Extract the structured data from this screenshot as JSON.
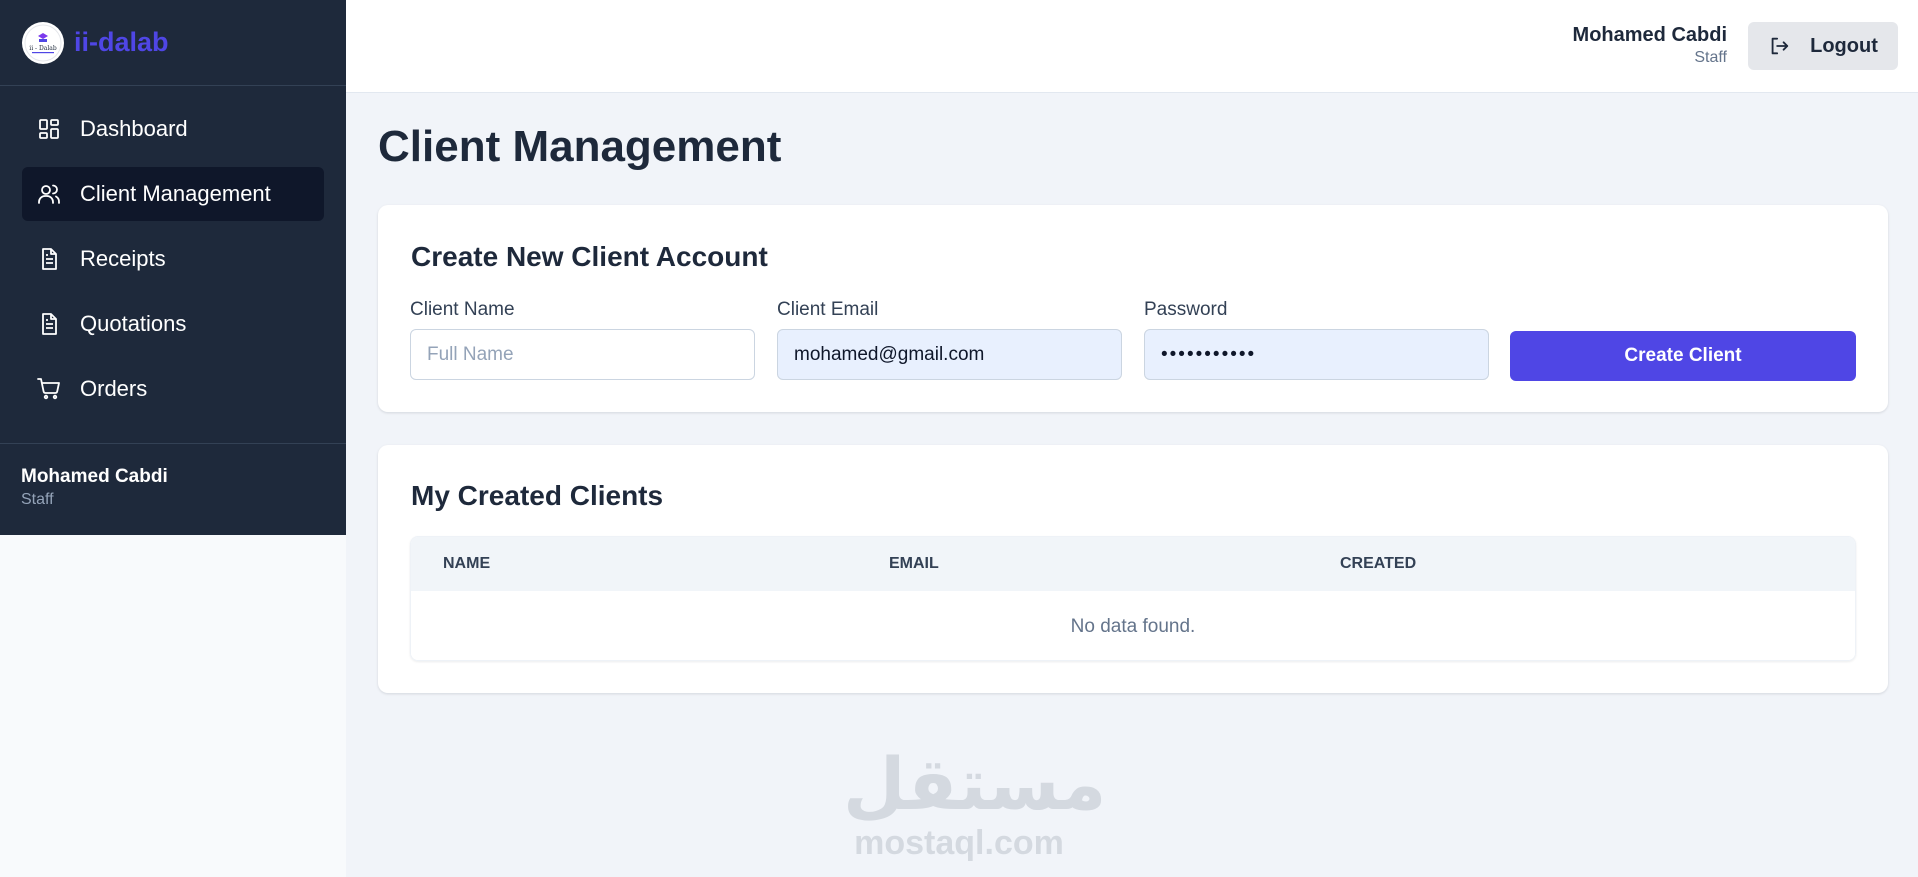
{
  "brand": {
    "name": "ii-dalab",
    "logo_text": "ii - Dalab"
  },
  "sidebar": {
    "items": [
      {
        "label": "Dashboard",
        "icon": "dashboard-icon"
      },
      {
        "label": "Client Management",
        "icon": "users-icon",
        "active": true
      },
      {
        "label": "Receipts",
        "icon": "document-icon"
      },
      {
        "label": "Quotations",
        "icon": "document-icon"
      },
      {
        "label": "Orders",
        "icon": "cart-icon"
      }
    ],
    "user": {
      "name": "Mohamed Cabdi",
      "role": "Staff"
    }
  },
  "header": {
    "user": {
      "name": "Mohamed Cabdi",
      "role": "Staff"
    },
    "logout_label": "Logout"
  },
  "page": {
    "title": "Client Management"
  },
  "create_form": {
    "title": "Create New Client Account",
    "client_name": {
      "label": "Client Name",
      "placeholder": "Full Name",
      "value": ""
    },
    "client_email": {
      "label": "Client Email",
      "value": "mohamed@gmail.com"
    },
    "password": {
      "label": "Password",
      "value": "•••••••••••"
    },
    "submit_label": "Create Client"
  },
  "clients_table": {
    "title": "My Created Clients",
    "columns": [
      "NAME",
      "EMAIL",
      "CREATED"
    ],
    "empty_message": "No data found."
  },
  "watermark": {
    "arabic": "مستقل",
    "latin": "mostaql.com"
  },
  "colors": {
    "sidebar_bg": "#1e293b",
    "accent": "#4f46e5",
    "page_bg": "#f1f4f9"
  }
}
